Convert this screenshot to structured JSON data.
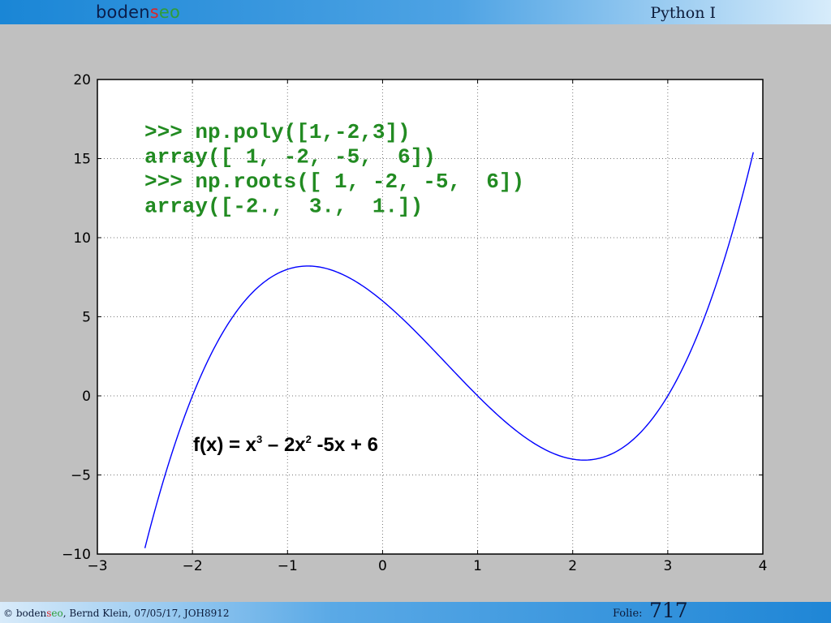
{
  "header": {
    "logo": {
      "part1": "boden",
      "part2": "s",
      "part3": "eo"
    },
    "course_title": "Python I"
  },
  "footer": {
    "copyright_symbol": "©",
    "logo": {
      "part1": "boden",
      "part2": "s",
      "part3": "eo"
    },
    "credit_rest": ", Bernd Klein, 07/05/17, JOH8912",
    "folie_label": "Folie:",
    "folie_number": "717"
  },
  "code_lines": [
    ">>> np.poly([1,-2,3])",
    "array([ 1, -2, -5,  6])",
    ">>> np.roots([ 1, -2, -5,  6])",
    "array([-2.,  3.,  1.])"
  ],
  "formula": {
    "prefix": "f(x) = x",
    "exp1": "3",
    "middle": " – 2x",
    "exp2": "2",
    "suffix": " -5x + 6"
  },
  "colors": {
    "code": "#228b22",
    "curve": "#0000ff",
    "background": "#c0c0c0",
    "plot_bg": "#ffffff"
  },
  "chart_data": {
    "type": "line",
    "function": "x^3 - 2x^2 - 5x + 6",
    "coefficients": [
      1,
      -2,
      -5,
      6
    ],
    "x_range": [
      -2.5,
      3.9
    ],
    "xlim": [
      -3,
      4
    ],
    "ylim": [
      -10,
      20
    ],
    "xticks": [
      -3,
      -2,
      -1,
      0,
      1,
      2,
      3,
      4
    ],
    "yticks": [
      -10,
      -5,
      0,
      5,
      10,
      15,
      20
    ],
    "xtick_labels": [
      "−3",
      "−2",
      "−1",
      "0",
      "1",
      "2",
      "3",
      "4"
    ],
    "ytick_labels": [
      "−10",
      "−5",
      "0",
      "5",
      "10",
      "15",
      "20"
    ],
    "grid": true
  }
}
